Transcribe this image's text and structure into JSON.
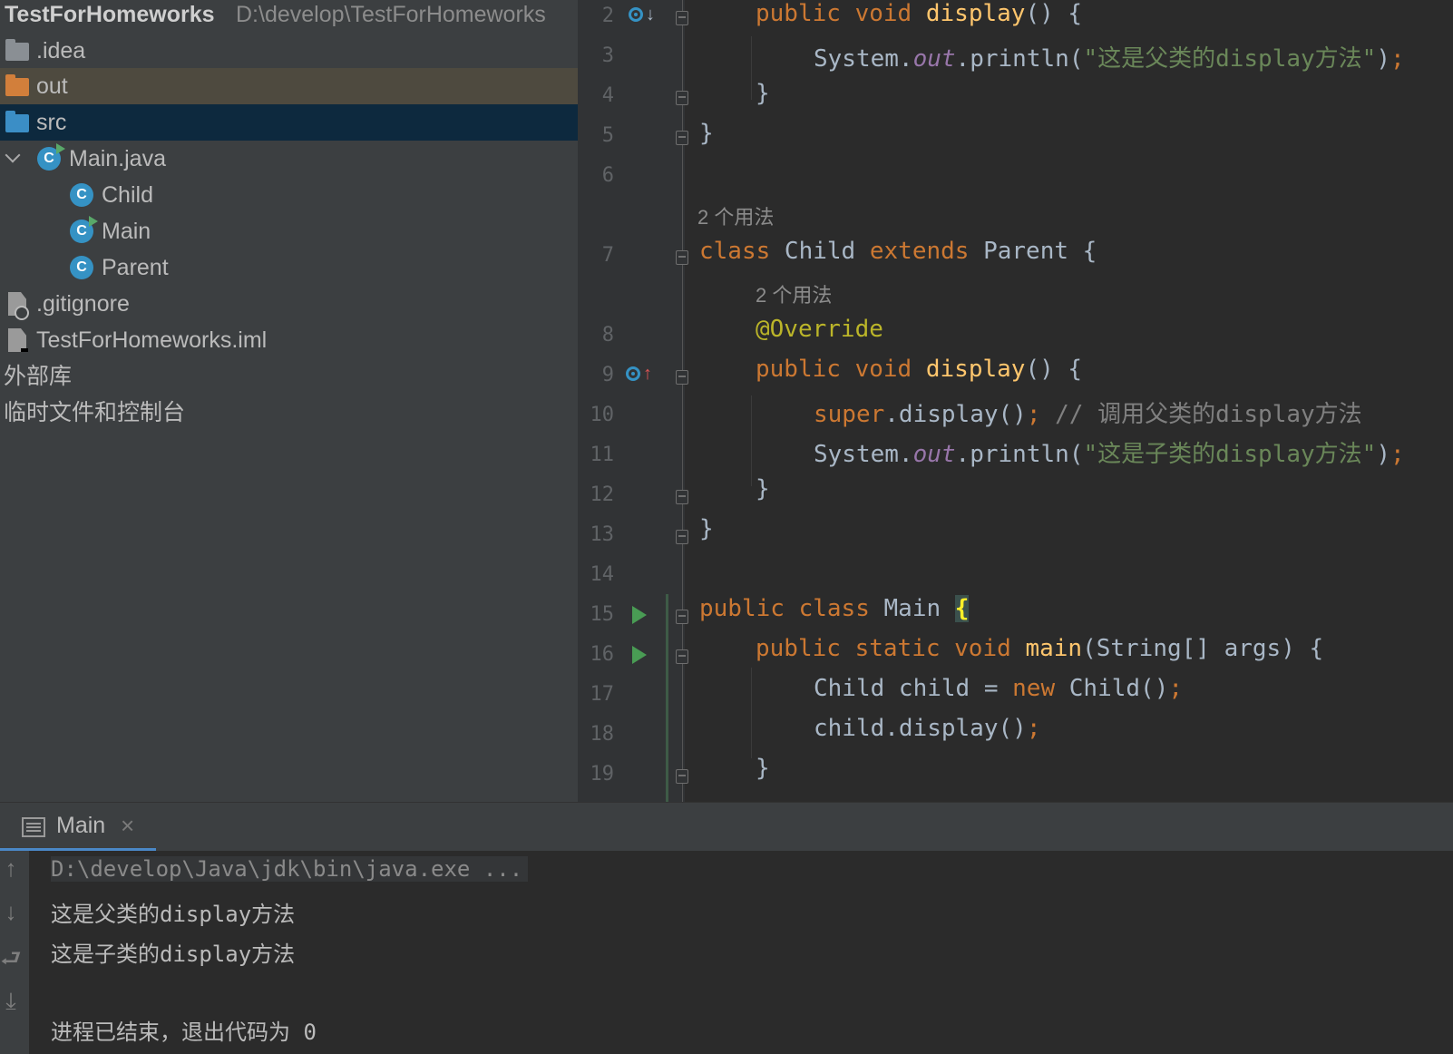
{
  "project": {
    "root_name": "TestForHomeworks",
    "root_path": "D:\\develop\\TestForHomeworks",
    "items": [
      {
        "label": ".idea",
        "icon": "folder-icon"
      },
      {
        "label": "out",
        "icon": "folder-icon"
      },
      {
        "label": "src",
        "icon": "folder-icon"
      },
      {
        "label": "Main.java",
        "icon": "java-class-icon"
      },
      {
        "label": "Child",
        "icon": "class-icon"
      },
      {
        "label": "Main",
        "icon": "class-icon"
      },
      {
        "label": "Parent",
        "icon": "class-icon"
      },
      {
        "label": ".gitignore",
        "icon": "ignore-file-icon"
      },
      {
        "label": "TestForHomeworks.iml",
        "icon": "module-file-icon"
      },
      {
        "label": "外部库"
      },
      {
        "label": "临时文件和控制台"
      }
    ],
    "class_icon_letter": "C"
  },
  "editor": {
    "line_numbers": [
      "2",
      "3",
      "4",
      "5",
      "6",
      "7",
      "8",
      "9",
      "10",
      "11",
      "12",
      "13",
      "14",
      "15",
      "16",
      "17",
      "18",
      "19"
    ],
    "usage_hint": "2 个用法",
    "lines": {
      "l2": {
        "kw1": "public",
        "kw2": "void",
        "fn": "display",
        "rest": "() {"
      },
      "l3": {
        "p1": "System.",
        "st": "out",
        "p2": ".println(",
        "str": "\"这是父类的display方法\"",
        "p3": ")",
        "semi": ";"
      },
      "l4": "}",
      "l5": "}",
      "l7": {
        "kw1": "class",
        "name": " Child ",
        "kw2": "extends",
        "rest": " Parent {"
      },
      "l8": "@Override",
      "l9": {
        "kw1": "public",
        "kw2": "void",
        "fn": "display",
        "rest": "() {"
      },
      "l10": {
        "kw": "super",
        "p1": ".display()",
        "semi": ";",
        "cm": " // 调用父类的display方法"
      },
      "l11": {
        "p1": "System.",
        "st": "out",
        "p2": ".println(",
        "str": "\"这是子类的display方法\"",
        "p3": ")",
        "semi": ";"
      },
      "l12": "}",
      "l13": "}",
      "l15": {
        "kw1": "public",
        "kw2": "class",
        "name": " Main ",
        "brace": "{"
      },
      "l16": {
        "kw1": "public",
        "kw2": "static",
        "kw3": "void",
        "fn": "main",
        "rest": "(String[] args) {"
      },
      "l17": {
        "p1": "Child child = ",
        "kw": "new",
        "p2": " Child()",
        "semi": ";"
      },
      "l18": {
        "p1": "child.display()",
        "semi": ";"
      },
      "l19": "}"
    }
  },
  "run": {
    "tab_label": "Main",
    "close_glyph": "×",
    "toolbar": {
      "up": "↑",
      "down": "↓",
      "wrap": "⮐",
      "scroll_end": "⤓"
    },
    "console": [
      "D:\\develop\\Java\\jdk\\bin\\java.exe ...",
      "这是父类的display方法",
      "这是子类的display方法",
      "进程已结束，退出代码为 0"
    ]
  }
}
